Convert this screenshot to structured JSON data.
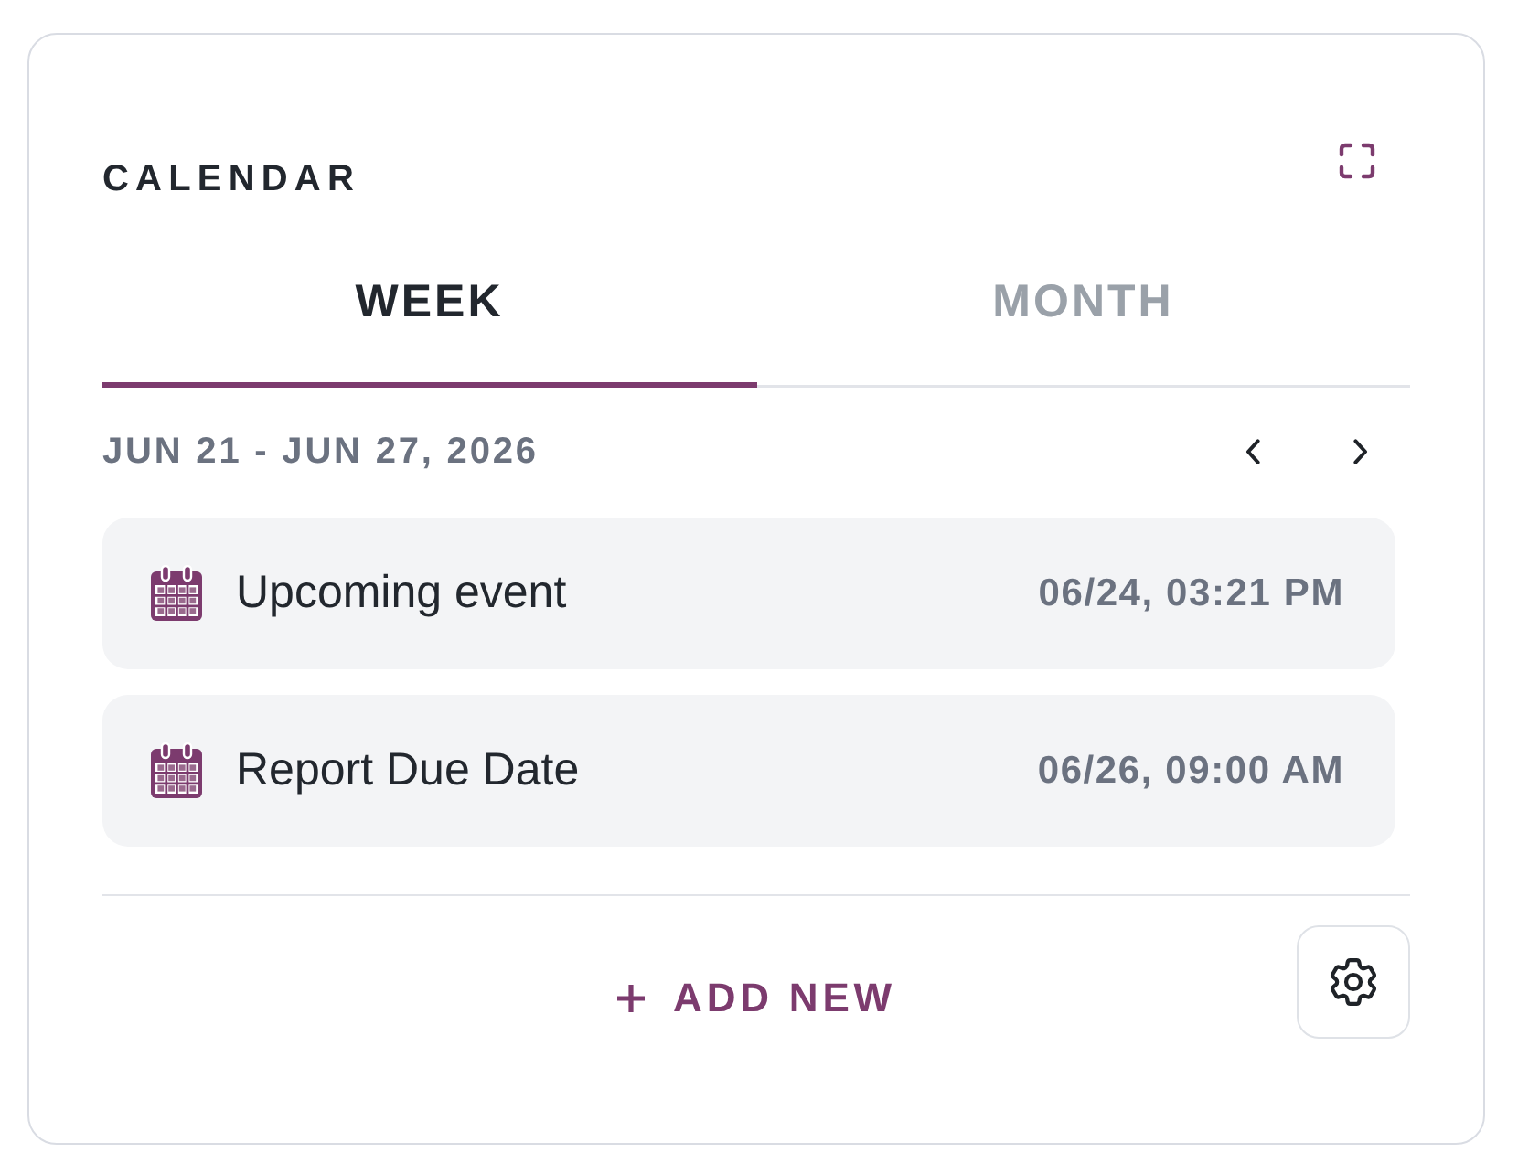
{
  "widget": {
    "title": "CALENDAR"
  },
  "tabs": [
    {
      "label": "WEEK",
      "selected": true
    },
    {
      "label": "MONTH",
      "selected": false
    }
  ],
  "range": {
    "label": "JUN 21 - JUN 27, 2026"
  },
  "events": [
    {
      "title": "Upcoming event",
      "time": "06/24, 03:21 PM"
    },
    {
      "title": "Report Due Date",
      "time": "06/26, 09:00 AM"
    }
  ],
  "footer": {
    "add_label": "ADD NEW"
  }
}
